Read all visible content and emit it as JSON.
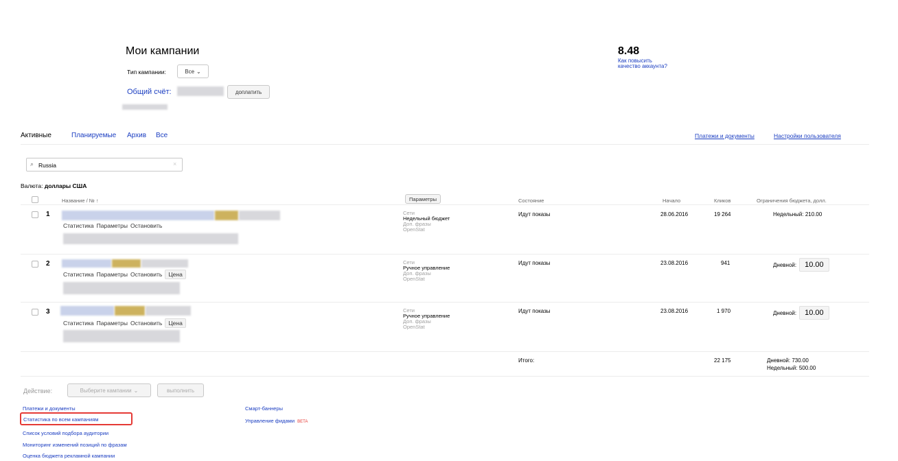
{
  "header": {
    "title": "Мои кампании",
    "campaign_type_label": "Тип кампании:",
    "campaign_type_value": "Все",
    "common_account_label": "Общий счёт:",
    "topup_label": "доплатить",
    "quality_score": "8.48",
    "quality_link": "Как повысить качество аккаунта?"
  },
  "tabs": {
    "active": "Активные",
    "planned": "Планируемые",
    "archive": "Архив",
    "all": "Все",
    "payments_docs": "Платежи и документы",
    "user_settings": "Настройки пользователя"
  },
  "search": {
    "value": "Russia"
  },
  "currency": {
    "label": "Валюта:",
    "value": "доллары США"
  },
  "table": {
    "col_name": "Название / № ↑",
    "col_params": "Параметры",
    "col_state": "Состояние",
    "col_start": "Начало",
    "col_clicks": "Кликов",
    "col_budget": "Ограничения бюджета, долл.",
    "rows": [
      {
        "num": "1",
        "link_stats": "Статистика",
        "link_params": "Параметры",
        "link_stop": "Остановить",
        "p_networks": "Сети",
        "p_strategy": "Недельный бюджет",
        "p_extra": "Доп. фразы",
        "p_openstat": "OpenStat",
        "state": "Идут показы",
        "start": "28.06.2016",
        "clicks": "19 264",
        "budget_label": "Недельный: 210.00"
      },
      {
        "num": "2",
        "link_stats": "Статистика",
        "link_params": "Параметры",
        "link_stop": "Остановить",
        "link_price": "Цена",
        "p_networks": "Сети",
        "p_strategy": "Ручное управление",
        "p_extra": "Доп. фразы",
        "p_openstat": "OpenStat",
        "state": "Идут показы",
        "start": "23.08.2016",
        "clicks": "941",
        "budget_label": "Дневной:",
        "budget_value": "10.00"
      },
      {
        "num": "3",
        "link_stats": "Статистика",
        "link_params": "Параметры",
        "link_stop": "Остановить",
        "link_price": "Цена",
        "p_networks": "Сети",
        "p_strategy": "Ручное управление",
        "p_extra": "Доп. фразы",
        "p_openstat": "OpenStat",
        "state": "Идут показы",
        "start": "23.08.2016",
        "clicks": "1 970",
        "budget_label": "Дневной:",
        "budget_value": "10.00"
      }
    ],
    "total_label": "Итого:",
    "total_clicks": "22 175",
    "total_daily": "Дневной: 730.00",
    "total_weekly": "Недельный: 500.00"
  },
  "actions": {
    "label": "Действие:",
    "select": "Выберите кампании",
    "execute": "выполнить"
  },
  "footer_links": {
    "col1": [
      "Платежи и документы",
      "Статистика по всем кампаниям",
      "Список условий подбора аудитории",
      "Мониторинг изменений позиций по фразам",
      "Оценка бюджета рекламной кампании"
    ],
    "smart_banners": "Смарт-баннеры",
    "feeds": "Управление фидами",
    "beta": "BETA"
  },
  "colors": {
    "link": "#1a3dc1",
    "highlight": "#e53935",
    "beta": "#e53935"
  }
}
